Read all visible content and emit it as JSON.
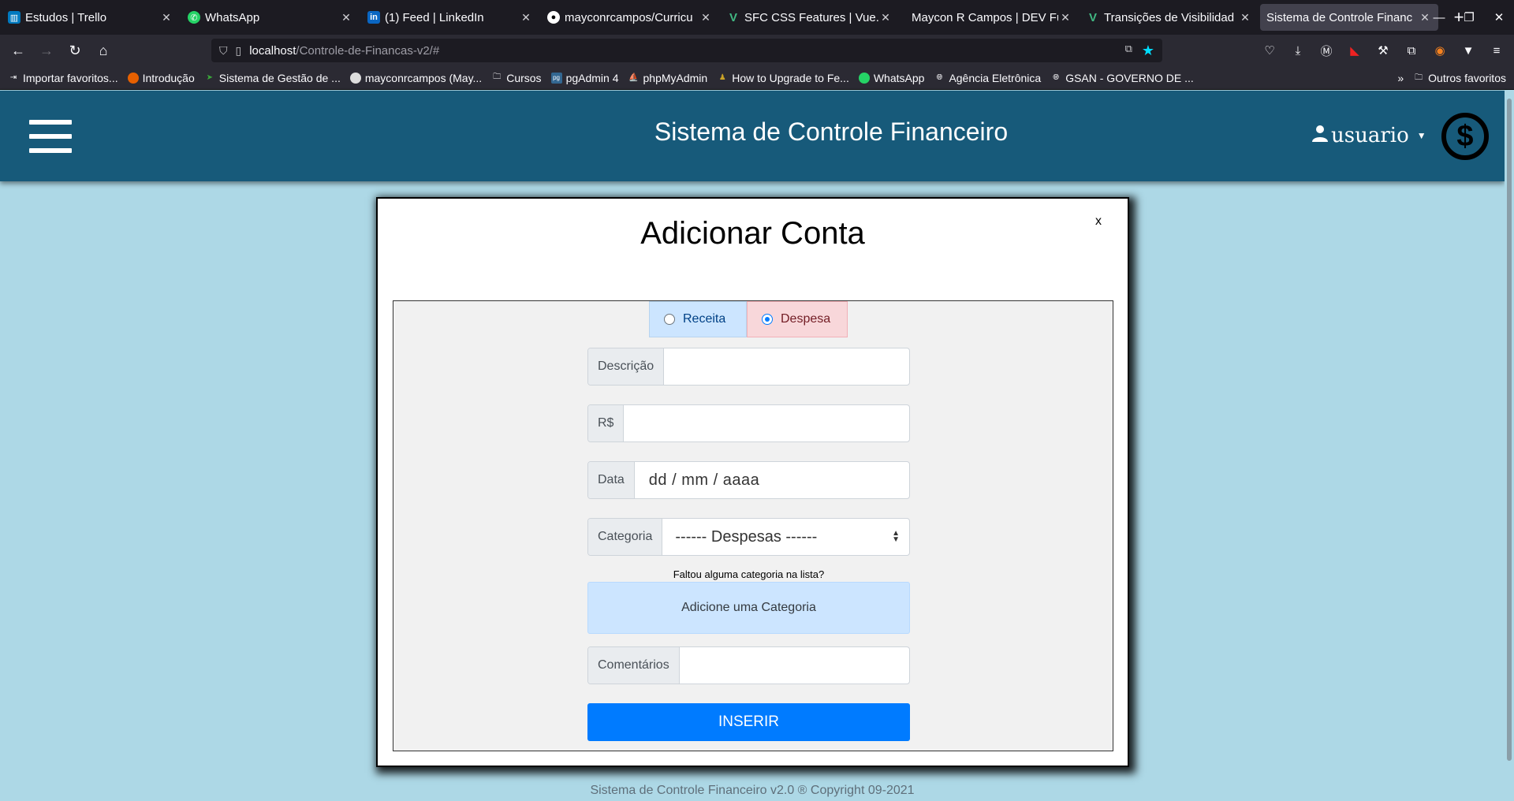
{
  "browser": {
    "tabs": [
      {
        "title": "Estudos | Trello",
        "icon": "trello-icon",
        "color": "#0079bf"
      },
      {
        "title": "WhatsApp",
        "icon": "whatsapp-icon",
        "color": "#25d366"
      },
      {
        "title": "(1) Feed | LinkedIn",
        "icon": "linkedin-icon",
        "color": "#0a66c2"
      },
      {
        "title": "mayconrcampos/Curricu",
        "icon": "github-icon",
        "color": "#ffffff"
      },
      {
        "title": "SFC CSS Features | Vue.j",
        "icon": "vue-icon",
        "color": "#41b883"
      },
      {
        "title": "Maycon R Campos | DEV Fu",
        "icon": "dev-icon",
        "color": "#1c1b22"
      },
      {
        "title": "Transições de Visibilidad",
        "icon": "vue-icon",
        "color": "#41b883"
      },
      {
        "title": "Sistema de Controle Financ",
        "icon": "none",
        "color": "#42414d"
      }
    ],
    "url_host": "localhost",
    "url_path": "/Controle-de-Financas-v2/#",
    "bookmarks": [
      {
        "label": "Importar favoritos...",
        "icon": "import-icon"
      },
      {
        "label": "Introdução",
        "icon": "firefox-icon"
      },
      {
        "label": "Sistema de Gestão de ...",
        "icon": "sg-icon"
      },
      {
        "label": "mayconrcampos (May...",
        "icon": "github-icon"
      },
      {
        "label": "Cursos",
        "icon": "folder-icon"
      },
      {
        "label": "pgAdmin 4",
        "icon": "pgadmin-icon"
      },
      {
        "label": "phpMyAdmin",
        "icon": "phpmyadmin-icon"
      },
      {
        "label": "How to Upgrade to Fe...",
        "icon": "howto-icon"
      },
      {
        "label": "WhatsApp",
        "icon": "whatsapp-icon"
      },
      {
        "label": "Agência Eletrônica",
        "icon": "globe-icon"
      },
      {
        "label": "GSAN - GOVERNO DE ...",
        "icon": "globe-icon"
      }
    ],
    "other_bookmarks": "Outros favoritos"
  },
  "header": {
    "title": "Sistema de Controle Financeiro",
    "user": "usuario",
    "logo_symbol": "$"
  },
  "modal": {
    "title": "Adicionar Conta",
    "close": "x",
    "type_options": [
      {
        "label": "Receita",
        "checked": false
      },
      {
        "label": "Despesa",
        "checked": true
      }
    ],
    "fields": {
      "descricao_label": "Descrição",
      "descricao_value": "",
      "valor_label": "R$",
      "valor_value": "",
      "data_label": "Data",
      "data_placeholder": "dd / mm / aaaa",
      "categoria_label": "Categoria",
      "categoria_selected": "------ Despesas ------",
      "comentarios_label": "Comentários",
      "comentarios_value": ""
    },
    "missing_text": "Faltou alguma categoria na lista?",
    "add_category": "Adicione uma Categoria",
    "submit": "INSERIR"
  },
  "footer": "Sistema de Controle Financeiro v2.0 ® Copyright 09-2021",
  "colors": {
    "header": "#175a7a",
    "background": "#add8e6",
    "primary": "#007bff"
  }
}
